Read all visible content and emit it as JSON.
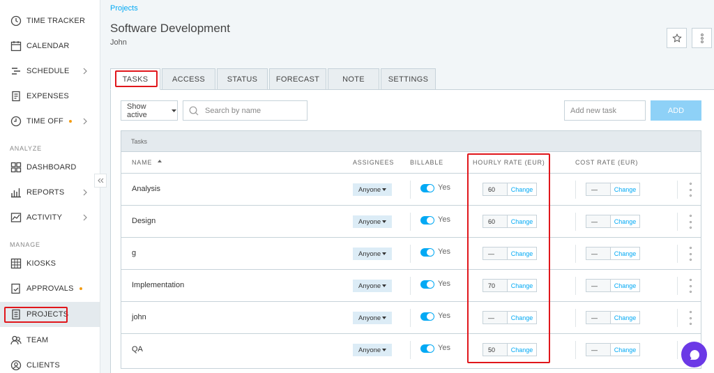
{
  "breadcrumb": "Projects",
  "project": {
    "title": "Software Development",
    "client": "John"
  },
  "sidebar": {
    "items": [
      {
        "label": "TIME TRACKER"
      },
      {
        "label": "CALENDAR"
      },
      {
        "label": "SCHEDULE"
      },
      {
        "label": "EXPENSES"
      },
      {
        "label": "TIME OFF"
      },
      {
        "label": "DASHBOARD"
      },
      {
        "label": "REPORTS"
      },
      {
        "label": "ACTIVITY"
      },
      {
        "label": "KIOSKS"
      },
      {
        "label": "APPROVALS"
      },
      {
        "label": "PROJECTS"
      },
      {
        "label": "TEAM"
      },
      {
        "label": "CLIENTS"
      }
    ],
    "sections": {
      "analyze": "ANALYZE",
      "manage": "MANAGE"
    }
  },
  "tabs": [
    "TASKS",
    "ACCESS",
    "STATUS",
    "FORECAST",
    "NOTE",
    "SETTINGS"
  ],
  "filter": {
    "status_label": "Show active",
    "search_placeholder": "Search by name"
  },
  "add_task": {
    "placeholder": "Add new task",
    "button": "ADD"
  },
  "table": {
    "group_title": "Tasks",
    "columns": {
      "name": "NAME",
      "assignees": "ASSIGNEES",
      "billable": "BILLABLE",
      "hourly_rate": "HOURLY RATE (EUR)",
      "cost_rate": "COST RATE (EUR)"
    },
    "rows": [
      {
        "name": "Analysis",
        "assignee": "Anyone",
        "billable": "Yes",
        "hourly": "60",
        "hourly_action": "Change",
        "cost": "—",
        "cost_action": "Change"
      },
      {
        "name": "Design",
        "assignee": "Anyone",
        "billable": "Yes",
        "hourly": "60",
        "hourly_action": "Change",
        "cost": "—",
        "cost_action": "Change"
      },
      {
        "name": "g",
        "assignee": "Anyone",
        "billable": "Yes",
        "hourly": "—",
        "hourly_action": "Change",
        "cost": "—",
        "cost_action": "Change"
      },
      {
        "name": "Implementation",
        "assignee": "Anyone",
        "billable": "Yes",
        "hourly": "70",
        "hourly_action": "Change",
        "cost": "—",
        "cost_action": "Change"
      },
      {
        "name": "john",
        "assignee": "Anyone",
        "billable": "Yes",
        "hourly": "—",
        "hourly_action": "Change",
        "cost": "—",
        "cost_action": "Change"
      },
      {
        "name": "QA",
        "assignee": "Anyone",
        "billable": "Yes",
        "hourly": "50",
        "hourly_action": "Change",
        "cost": "—",
        "cost_action": "Change"
      }
    ]
  },
  "colors": {
    "accent": "#03a9f4",
    "highlight": "#e0161b",
    "chat": "#6b39e6"
  }
}
